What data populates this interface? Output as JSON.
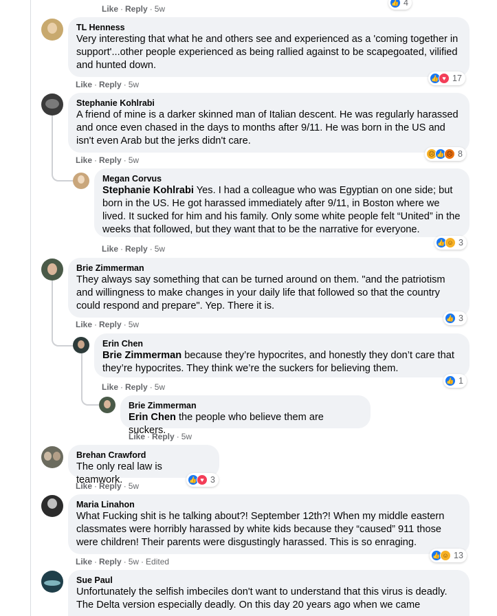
{
  "top_meta": {
    "like": "Like",
    "reply": "Reply",
    "time": "5w"
  },
  "top_reaction": {
    "count": "4"
  },
  "comments": [
    {
      "author": "TL Henness",
      "text": "Very interesting that what he and others see and experienced as a 'coming together in support'...other people experienced as being rallied against to be scapegoated, vilified and hunted down.",
      "like": "Like",
      "reply": "Reply",
      "time": "5w",
      "reaction_count": "17"
    },
    {
      "author": "Stephanie Kohlrabi",
      "text": "A friend of mine is a darker skinned man of Italian descent. He was regularly harassed and once even chased in the days to months after 9/11. He was born in the US and isn't even Arab but the jerks didn't care.",
      "like": "Like",
      "reply": "Reply",
      "time": "5w",
      "reaction_count": "8"
    },
    {
      "author": "Megan Corvus",
      "mention": "Stephanie Kohlrabi",
      "text": " Yes. I had a colleague who was Egyptian on one side; but born in the US. He got harassed immediately after 9/11, in Boston where we lived. It sucked for him and his family. Only some white people felt “United” in the weeks that followed, but they want that to be the narrative for everyone.",
      "like": "Like",
      "reply": "Reply",
      "time": "5w",
      "reaction_count": "3"
    },
    {
      "author": "Brie Zimmerman",
      "text": "They always say something that can be turned around on them. \"and the patriotism and willingness to make changes in your daily life that followed so that the country could respond and prepare\". Yep. There it is.",
      "like": "Like",
      "reply": "Reply",
      "time": "5w",
      "reaction_count": "3"
    },
    {
      "author": "Erin Chen",
      "mention": "Brie Zimmerman",
      "text": " because they’re hypocrites, and honestly they don’t care that they’re hypocrites. They think we’re the suckers for believing them.",
      "like": "Like",
      "reply": "Reply",
      "time": "5w",
      "reaction_count": "1"
    },
    {
      "author": "Brie Zimmerman",
      "mention": "Erin Chen",
      "text": " the people who believe them are suckers.",
      "like": "Like",
      "reply": "Reply",
      "time": "5w"
    },
    {
      "author": "Brehan Crawford",
      "text": "The only real law is teamwork.",
      "like": "Like",
      "reply": "Reply",
      "time": "5w",
      "reaction_count": "3"
    },
    {
      "author": "Maria Linahon",
      "text": "What Fucking shit is he talking about?! September 12th?! When my middle eastern classmates were horribly harassed by white kids because they “caused” 911 those were children! Their parents were disgustingly harassed. This is so enraging.",
      "like": "Like",
      "reply": "Reply",
      "time": "5w",
      "edited": "Edited",
      "reaction_count": "13"
    },
    {
      "author": "Sue Paul",
      "text": "Unfortunately the selfish imbeciles don't want to understand that this virus is deadly. The Delta version especially deadly. On this day 20 years ago when we came"
    }
  ],
  "icons": [
    "like-reaction-icon",
    "love-reaction-icon",
    "care-reaction-icon",
    "sad-reaction-icon",
    "angry-reaction-icon"
  ],
  "colors": {
    "bubble": "#f0f2f5",
    "meta_text": "#65676b",
    "like_blue": "#1877f2",
    "love_red": "#f33e58",
    "reaction_yellow": "#f7b125",
    "angry_orange": "#e9710f",
    "thread_line": "#ced0d4"
  }
}
